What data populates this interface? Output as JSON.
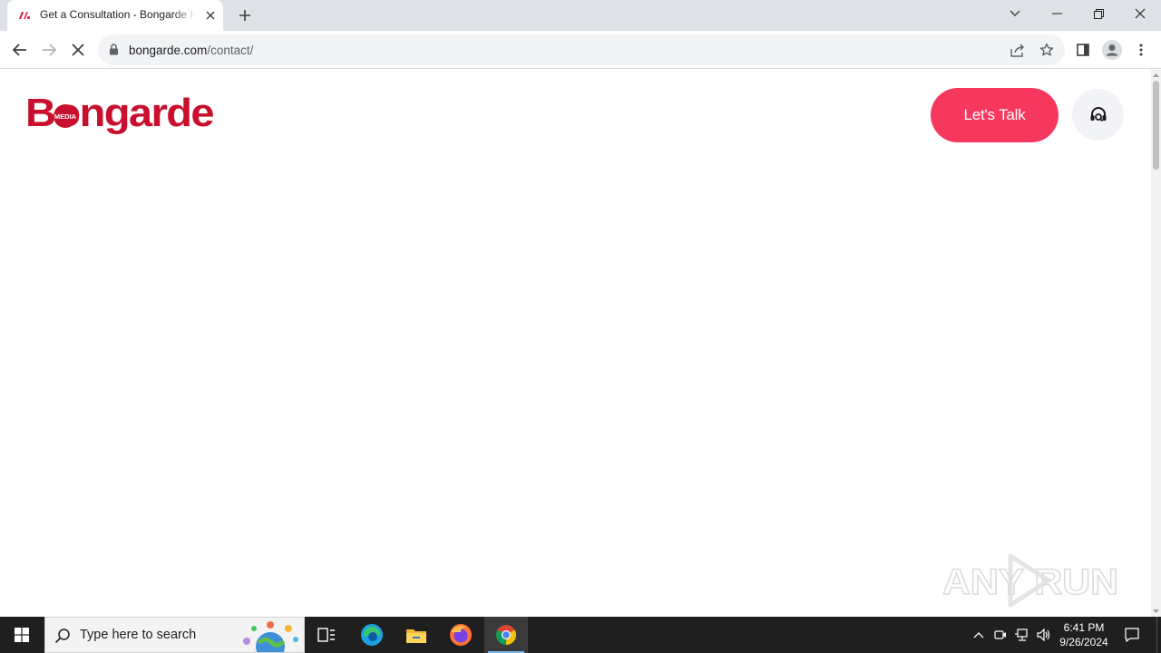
{
  "browser": {
    "tab": {
      "title": "Get a Consultation - Bongarde H"
    },
    "url": {
      "host": "bongarde.com",
      "path": "/contact/"
    }
  },
  "page": {
    "logo": {
      "text": "Bongarde",
      "badge": "MEDIA"
    },
    "cta_label": "Let's Talk",
    "watermark": "ANY RUN"
  },
  "taskbar": {
    "search_placeholder": "Type here to search",
    "time": "6:41 PM",
    "date": "9/26/2024"
  },
  "colors": {
    "brand_red": "#c8102e",
    "cta_pink": "#f7385e",
    "taskbar": "#1f1f1f"
  }
}
